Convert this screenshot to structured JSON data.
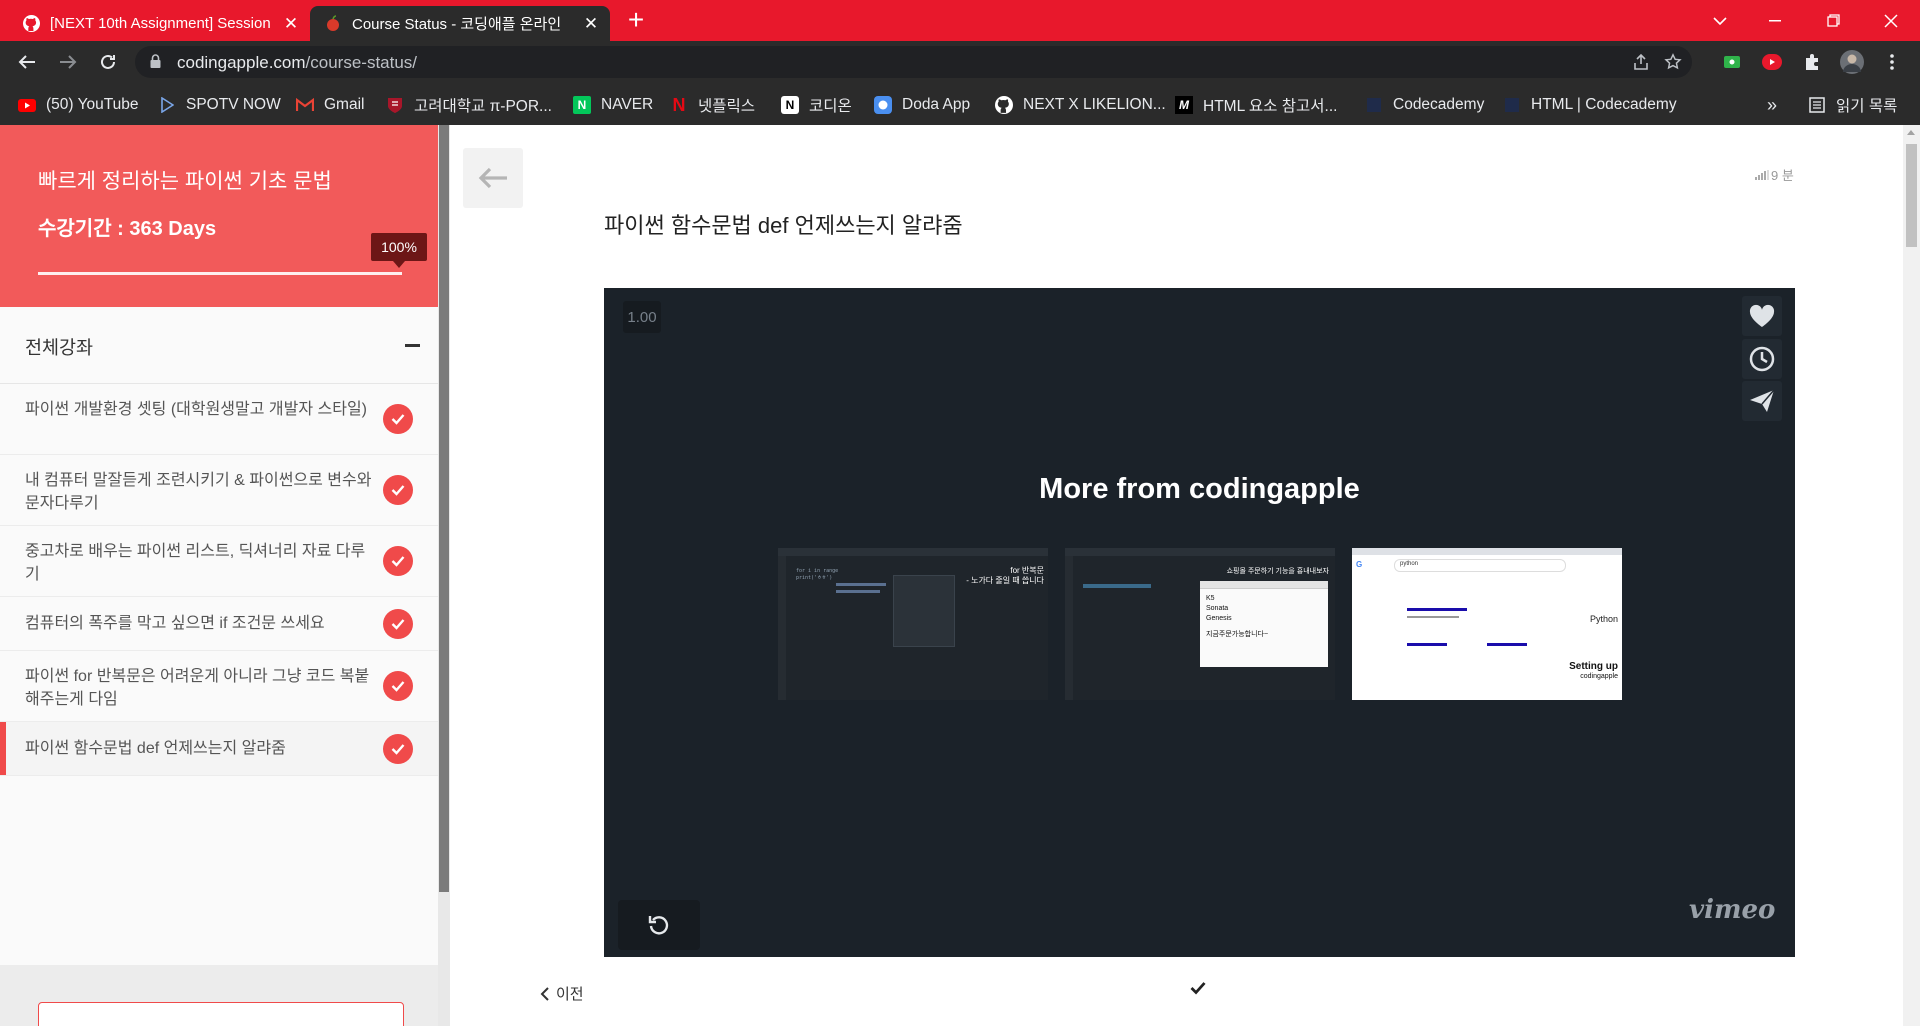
{
  "browser": {
    "tabs": [
      {
        "title": "[NEXT 10th Assignment] Session",
        "favicon": "github-icon"
      },
      {
        "title": "Course Status - 코딩애플 온라인",
        "favicon": "apple-icon"
      }
    ],
    "url_domain": "codingapple.com",
    "url_path": "/course-status/",
    "bookmarks": [
      {
        "label": "(50) YouTube",
        "icon": "youtube-icon"
      },
      {
        "label": "SPOTV NOW",
        "icon": "play-icon"
      },
      {
        "label": "Gmail",
        "icon": "gmail-icon"
      },
      {
        "label": "고려대학교 π-POR...",
        "icon": "shield-icon"
      },
      {
        "label": "NAVER",
        "icon": "naver-icon"
      },
      {
        "label": "넷플릭스",
        "icon": "netflix-icon"
      },
      {
        "label": "코디온",
        "icon": "notion-icon"
      },
      {
        "label": "Doda App",
        "icon": "circle-icon"
      },
      {
        "label": "NEXT X LIKELION...",
        "icon": "github-icon"
      },
      {
        "label": "HTML 요소 참고서...",
        "icon": "mdn-icon"
      },
      {
        "label": "Codecademy",
        "icon": "page-icon"
      },
      {
        "label": "HTML | Codecademy",
        "icon": "page-icon"
      }
    ],
    "reading_list_label": "읽기 목록",
    "bookmarks_overflow": "»"
  },
  "sidebar": {
    "course_title": "빠르게 정리하는 파이썬 기초 문법",
    "period": "수강기간 : 363 Days",
    "progress_label": "100%",
    "progress": 1.0,
    "section_label": "전체강좌",
    "lessons": [
      {
        "title": "파이썬 개발환경 셋팅 (대학원생말고 개발자 스타일)",
        "done": true
      },
      {
        "title": "내 컴퓨터 말잘듣게 조련시키기 & 파이썬으로 변수와 문자다루기",
        "done": true
      },
      {
        "title": "중고차로 배우는 파이썬 리스트, 딕셔너리 자료 다루기",
        "done": true
      },
      {
        "title": "컴퓨터의 폭주를 막고 싶으면 if 조건문 쓰세요",
        "done": true
      },
      {
        "title": "파이썬 for 반복문은 어려운게 아니라 그냥 코드 복붙해주는게 다임",
        "done": true
      },
      {
        "title": "파이썬 함수문법 def 언제쓰는지 알랴줌",
        "done": true,
        "active": true
      }
    ]
  },
  "main": {
    "duration": "9 분",
    "lesson_title": "파이썬 함수문법 def 언제쓰는지 알랴줌",
    "video": {
      "speed": "1.00",
      "more_title": "More from codingapple",
      "thumbs": [
        {
          "caption": "for 반복문",
          "sub": "- 노가다 줄일 때 씁니다",
          "code": [
            "for i in range",
            "print('ㅎㅎ')"
          ]
        },
        {
          "caption": "쇼핑몰 주문하기 기능을 흉내내보자",
          "items": [
            "K5",
            "Sonata",
            "Genesis"
          ],
          "note": "지금주문가능합니다~"
        },
        {
          "caption": "Setting up",
          "sub": "codingapple",
          "search": "python",
          "side": "Python"
        }
      ],
      "brand": "vimeo"
    },
    "prev_label": "이전"
  }
}
